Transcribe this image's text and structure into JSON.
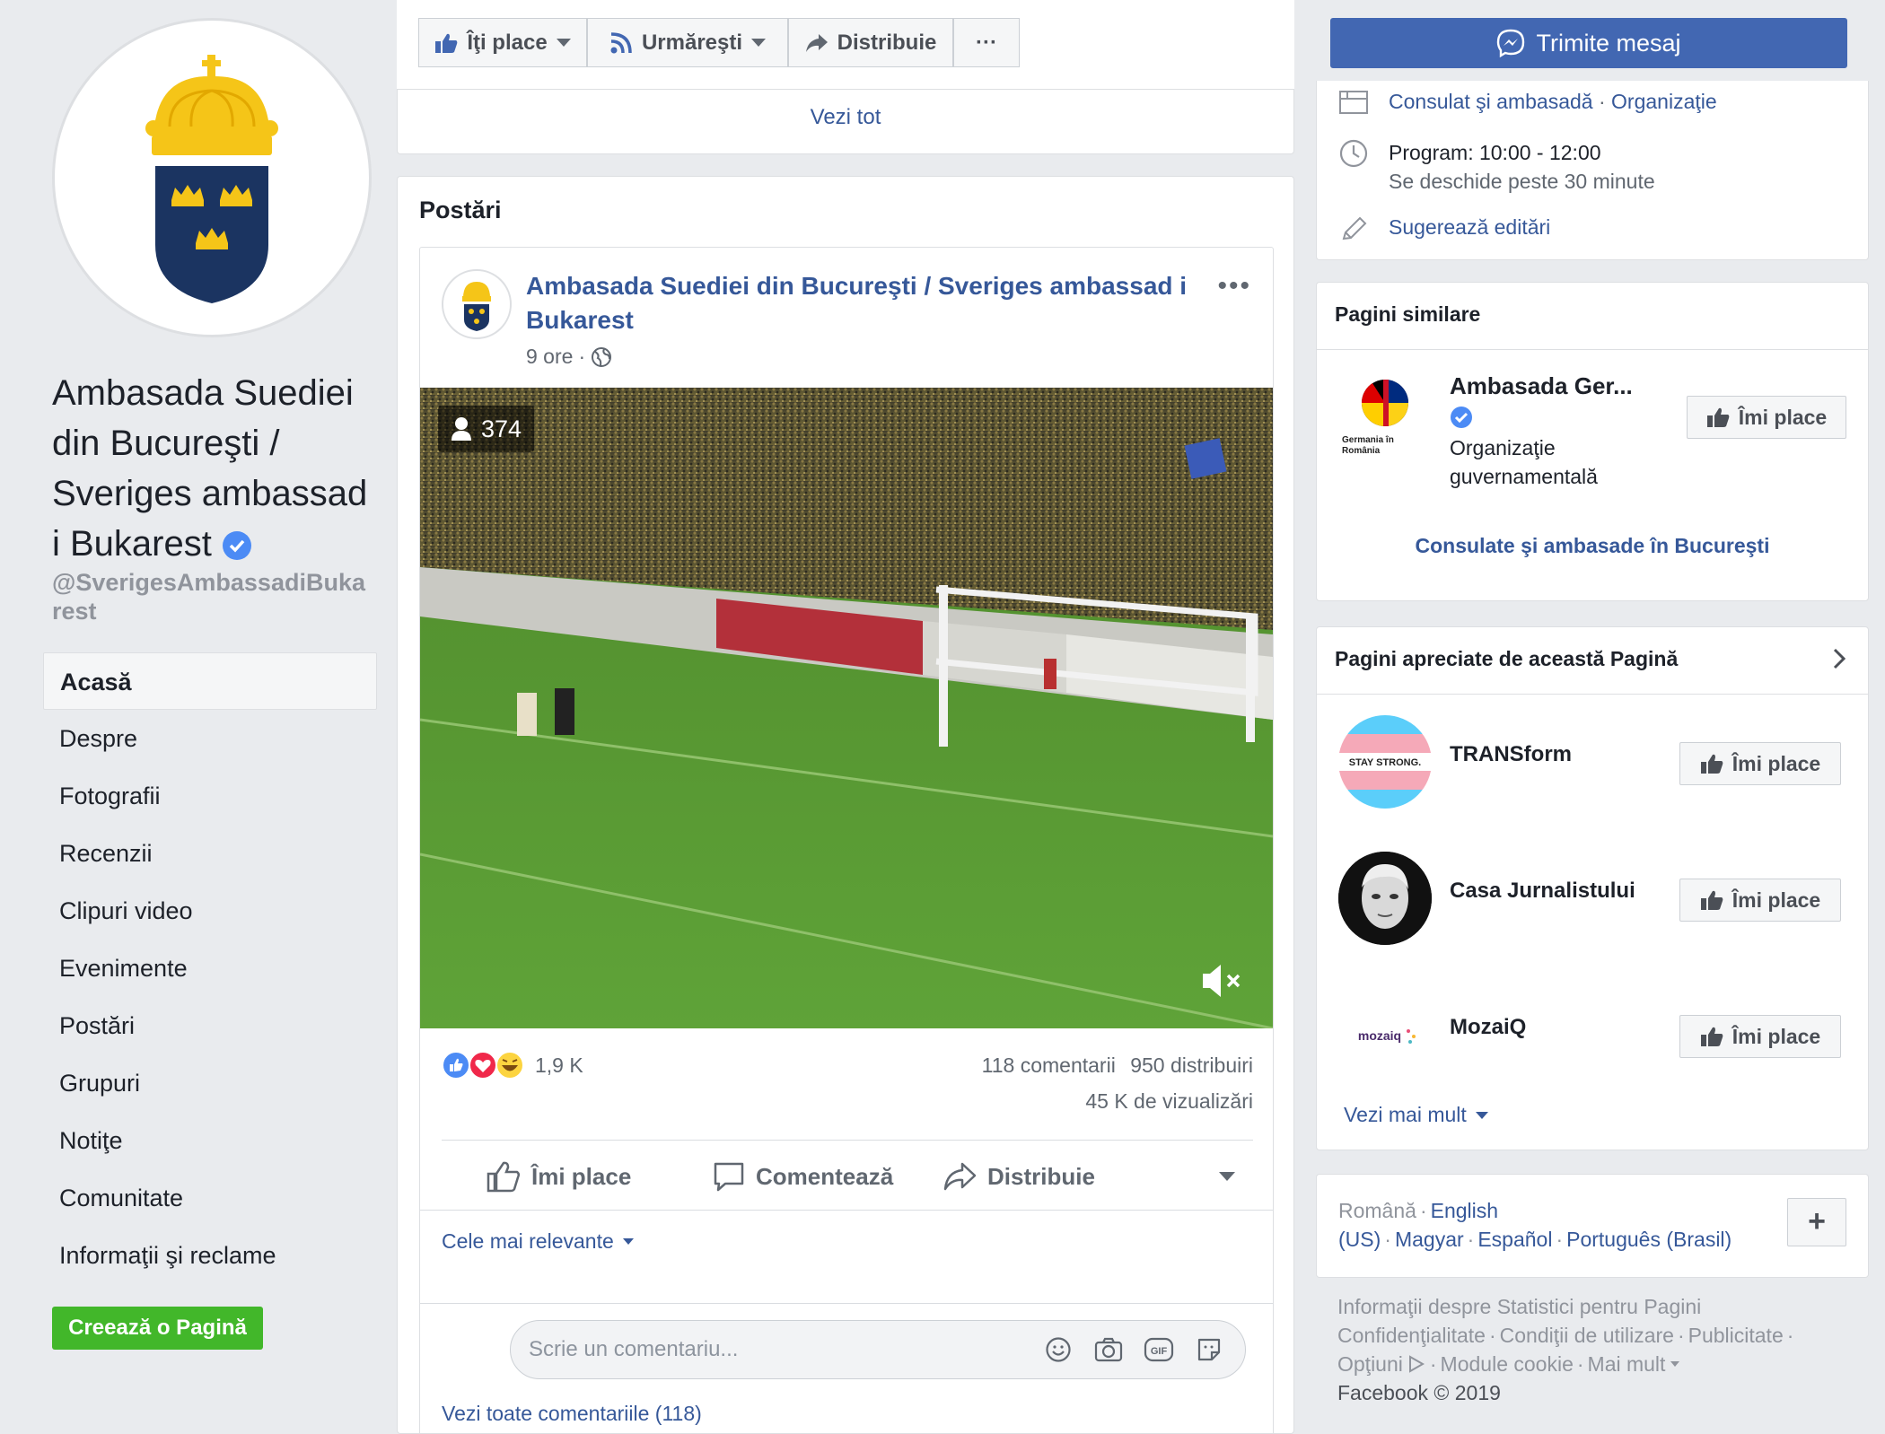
{
  "page": {
    "name": "Ambasada Suediei din Bucureşti / Sveriges ambassad i Bukarest",
    "handle": "@SverigesAmbassadiBukarest"
  },
  "nav": {
    "items": [
      {
        "label": "Acasă",
        "active": true
      },
      {
        "label": "Despre"
      },
      {
        "label": "Fotografii"
      },
      {
        "label": "Recenzii"
      },
      {
        "label": "Clipuri video"
      },
      {
        "label": "Evenimente"
      },
      {
        "label": "Postări"
      },
      {
        "label": "Grupuri"
      },
      {
        "label": "Notiţe"
      },
      {
        "label": "Comunitate"
      },
      {
        "label": "Informaţii şi reclame"
      }
    ],
    "create_page": "Creează o Pagină"
  },
  "toolbar": {
    "like": "Îţi place",
    "follow": "Urmăreşti",
    "share": "Distribuie",
    "more": "···",
    "see_all": "Vezi tot"
  },
  "posts": {
    "title": "Postări",
    "post": {
      "author": "Ambasada Suediei din Bucureşti / Sveriges ambassad i Bukarest",
      "time": "9 ore",
      "time_sep": "·",
      "viewers": "374",
      "reaction_count": "1,9 K",
      "comments": "118 comentarii",
      "shares": "950 distribuiri",
      "views": "45 K de vizualizări",
      "actions": {
        "like": "Îmi place",
        "comment": "Comentează",
        "share": "Distribuie"
      },
      "relevance": "Cele mai relevante",
      "comment_placeholder": "Scrie un comentariu...",
      "view_all_comments": "Vezi toate comentariile (118)"
    }
  },
  "right": {
    "send_message": "Trimite mesaj",
    "info": {
      "category_1": "Consulat şi ambasadă",
      "category_sep": "·",
      "category_2": "Organizaţie",
      "hours": "Program: 10:00 - 12:00",
      "opens": "Se deschide peste 30 minute",
      "suggest_edits": "Sugerează editări"
    },
    "similar": {
      "title": "Pagini similare",
      "name": "Ambasada Ger...",
      "logo_caption_1": "Germania în",
      "logo_caption_2": "România",
      "type_1": "Organizaţie",
      "type_2": "guvernamentală",
      "like": "Îmi place",
      "link": "Consulate şi ambasade în Bucureşti"
    },
    "liked": {
      "title": "Pagini apreciate de această Pagină",
      "items": [
        {
          "name": "TRANSform",
          "avatar_text": "STAY STRONG.",
          "like": "Îmi place"
        },
        {
          "name": "Casa Jurnalistului",
          "like": "Îmi place"
        },
        {
          "name": "MozaiQ",
          "avatar_text": "mozaiq",
          "like": "Îmi place"
        }
      ],
      "see_more": "Vezi mai mult"
    },
    "languages": {
      "current": "Română",
      "others": [
        "English (US)",
        "Magyar",
        "Español",
        "Português (Brasil)"
      ],
      "plus": "+"
    },
    "footer": {
      "links_1": [
        "Informaţii despre Statistici pentru Pagini"
      ],
      "links_2": [
        "Confidenţialitate",
        "Condiţii de utilizare",
        "Publicitate"
      ],
      "links_3": [
        "Opţiuni",
        "Module cookie",
        "Mai mult"
      ],
      "copyright": "Facebook © 2019"
    }
  },
  "colors": {
    "fb_blue": "#4267b2",
    "link_blue": "#365899",
    "green": "#42b72a",
    "crest_blue": "#1b3461",
    "crest_yellow": "#f5c518"
  }
}
